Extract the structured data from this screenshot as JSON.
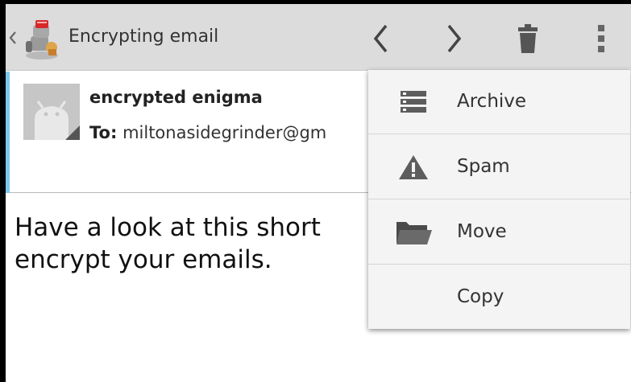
{
  "actionbar": {
    "title": "Encrypting email",
    "icons": {
      "up": "chevron-left-icon",
      "app": "app-robot-icon",
      "prev": "chevron-left-icon",
      "next": "chevron-right-icon",
      "delete": "trash-icon",
      "overflow": "more-vertical-icon"
    },
    "background": "#dcdcdc"
  },
  "message": {
    "sender": "encrypted enigma",
    "to_label": "To:",
    "to_value": "miltonasidegrinder@gm",
    "body": "Have a look at this short encrypt your emails.",
    "body_line1": "Have a look at this short ",
    "body_line2": "encrypt your emails.",
    "accent": "#7ec6ef"
  },
  "menu": {
    "items": [
      {
        "label": "Archive",
        "icon": "archive-icon"
      },
      {
        "label": "Spam",
        "icon": "warning-icon"
      },
      {
        "label": "Move",
        "icon": "folder-icon"
      },
      {
        "label": "Copy",
        "icon": ""
      }
    ]
  }
}
